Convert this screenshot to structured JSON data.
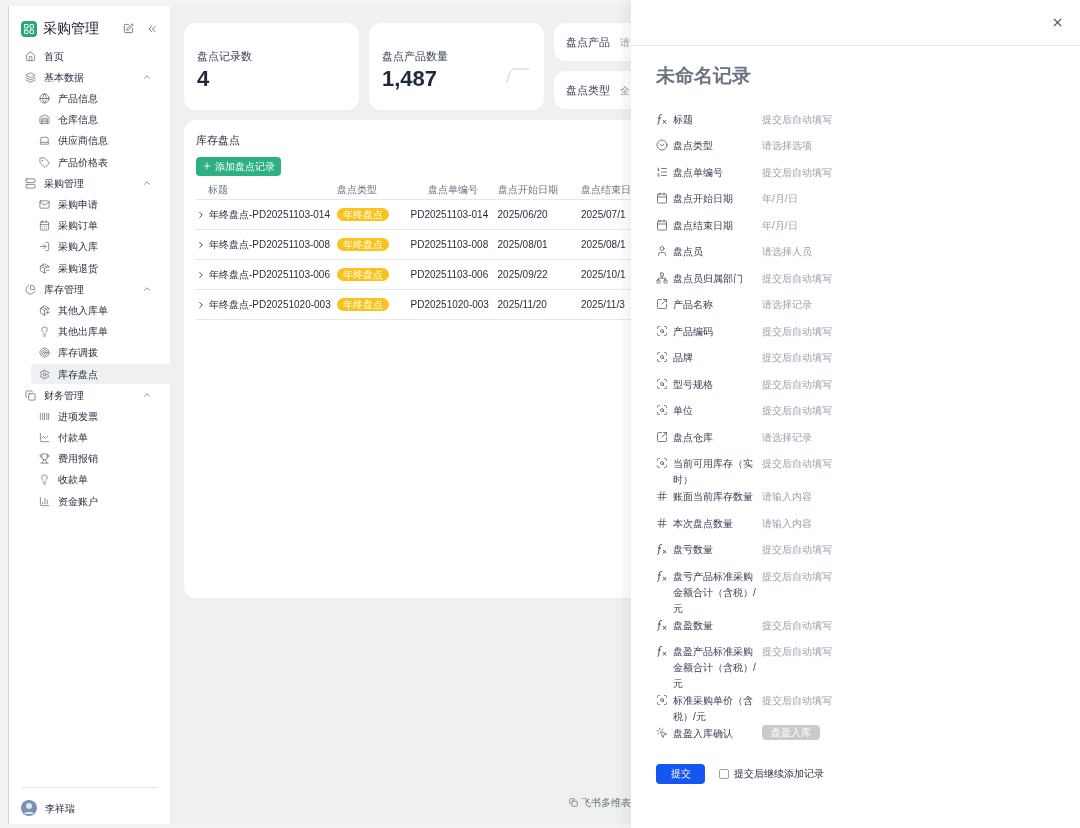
{
  "sidebar": {
    "app_title": "采购管理",
    "home": {
      "label": "首页",
      "selected": false
    },
    "groups": [
      {
        "label": "基本数据",
        "expanded": true,
        "children": [
          {
            "label": "产品信息",
            "selected": false
          },
          {
            "label": "仓库信息",
            "selected": false
          },
          {
            "label": "供应商信息",
            "selected": false
          },
          {
            "label": "产品价格表",
            "selected": false
          }
        ]
      },
      {
        "label": "采购管理",
        "expanded": true,
        "children": [
          {
            "label": "采购申请",
            "selected": false
          },
          {
            "label": "采购订单",
            "selected": false
          },
          {
            "label": "采购入库",
            "selected": false
          },
          {
            "label": "采购退货",
            "selected": false
          }
        ]
      },
      {
        "label": "库存管理",
        "expanded": true,
        "children": [
          {
            "label": "其他入库单",
            "selected": false
          },
          {
            "label": "其他出库单",
            "selected": false
          },
          {
            "label": "库存调拨",
            "selected": false
          },
          {
            "label": "库存盘点",
            "selected": true
          }
        ]
      },
      {
        "label": "财务管理",
        "expanded": true,
        "children": [
          {
            "label": "进项发票",
            "selected": false
          },
          {
            "label": "付款单",
            "selected": false
          },
          {
            "label": "费用报销",
            "selected": false
          },
          {
            "label": "收款单",
            "selected": false
          },
          {
            "label": "资金账户",
            "selected": false
          }
        ]
      }
    ],
    "user": {
      "name": "李祥瑞"
    }
  },
  "stats": [
    {
      "label": "盘点记录数",
      "value": "4"
    },
    {
      "label": "盘点产品数量",
      "value": "1,487"
    }
  ],
  "filters": [
    {
      "label": "盘点产品",
      "value": "请"
    },
    {
      "label": "盘点类型",
      "value": "全"
    }
  ],
  "table": {
    "title": "库存盘点",
    "add_button": "添加盘点记录",
    "columns": [
      "标题",
      "盘点类型",
      "盘点单编号",
      "盘点开始日期",
      "盘点结束日"
    ],
    "rows": [
      {
        "title": "年终盘点-PD20251103-014",
        "type": "年终盘点",
        "number": "PD20251103-014",
        "start": "2025/06/20",
        "end": "2025/07/1"
      },
      {
        "title": "年终盘点-PD20251103-008",
        "type": "年终盘点",
        "number": "PD20251103-008",
        "start": "2025/08/01",
        "end": "2025/08/1"
      },
      {
        "title": "年终盘点-PD20251103-006",
        "type": "年终盘点",
        "number": "PD20251103-006",
        "start": "2025/09/22",
        "end": "2025/10/1"
      },
      {
        "title": "年终盘点-PD20251020-003",
        "type": "年终盘点",
        "number": "PD20251020-003",
        "start": "2025/11/20",
        "end": "2025/11/3"
      }
    ]
  },
  "footer_brand": "飞书多维表",
  "drawer": {
    "title": "未命名记录",
    "fields": [
      {
        "kind": "formula",
        "label": "标题",
        "placeholder": "提交后自动填写"
      },
      {
        "kind": "select",
        "label": "盘点类型",
        "placeholder": "请选择选项"
      },
      {
        "kind": "autonumber",
        "label": "盘点单编号",
        "placeholder": "提交后自动填写"
      },
      {
        "kind": "date",
        "label": "盘点开始日期",
        "placeholder": "年/月/日"
      },
      {
        "kind": "date",
        "label": "盘点结束日期",
        "placeholder": "年/月/日"
      },
      {
        "kind": "person",
        "label": "盘点员",
        "placeholder": "请选择人员"
      },
      {
        "kind": "department",
        "label": "盘点员归属部门",
        "placeholder": "提交后自动填写"
      },
      {
        "kind": "link",
        "label": "产品名称",
        "placeholder": "请选择记录"
      },
      {
        "kind": "lookup",
        "label": "产品编码",
        "placeholder": "提交后自动填写"
      },
      {
        "kind": "lookup",
        "label": "品牌",
        "placeholder": "提交后自动填写"
      },
      {
        "kind": "lookup",
        "label": "型号规格",
        "placeholder": "提交后自动填写"
      },
      {
        "kind": "lookup",
        "label": "单位",
        "placeholder": "提交后自动填写"
      },
      {
        "kind": "link",
        "label": "盘点仓库",
        "placeholder": "请选择记录"
      },
      {
        "kind": "lookup",
        "label": "当前可用库存（实时）",
        "placeholder": "提交后自动填写"
      },
      {
        "kind": "number",
        "label": "账面当前库存数量",
        "placeholder": "请输入内容"
      },
      {
        "kind": "number",
        "label": "本次盘点数量",
        "placeholder": "请输入内容"
      },
      {
        "kind": "formula",
        "label": "盘亏数量",
        "placeholder": "提交后自动填写"
      },
      {
        "kind": "formula",
        "label": "盘亏产品标准采购金额合计（含税）/元",
        "placeholder": "提交后自动填写"
      },
      {
        "kind": "formula",
        "label": "盘盈数量",
        "placeholder": "提交后自动填写"
      },
      {
        "kind": "formula",
        "label": "盘盈产品标准采购金额合计（含税）/元",
        "placeholder": "提交后自动填写"
      },
      {
        "kind": "lookup",
        "label": "标准采购单价（含税）/元",
        "placeholder": "提交后自动填写"
      },
      {
        "kind": "button",
        "label": "盘盈入库确认",
        "button": "盘盈入库",
        "disabled": true
      }
    ],
    "submit": "提交",
    "continue": {
      "label": "提交后继续添加记录",
      "checked": false
    }
  }
}
